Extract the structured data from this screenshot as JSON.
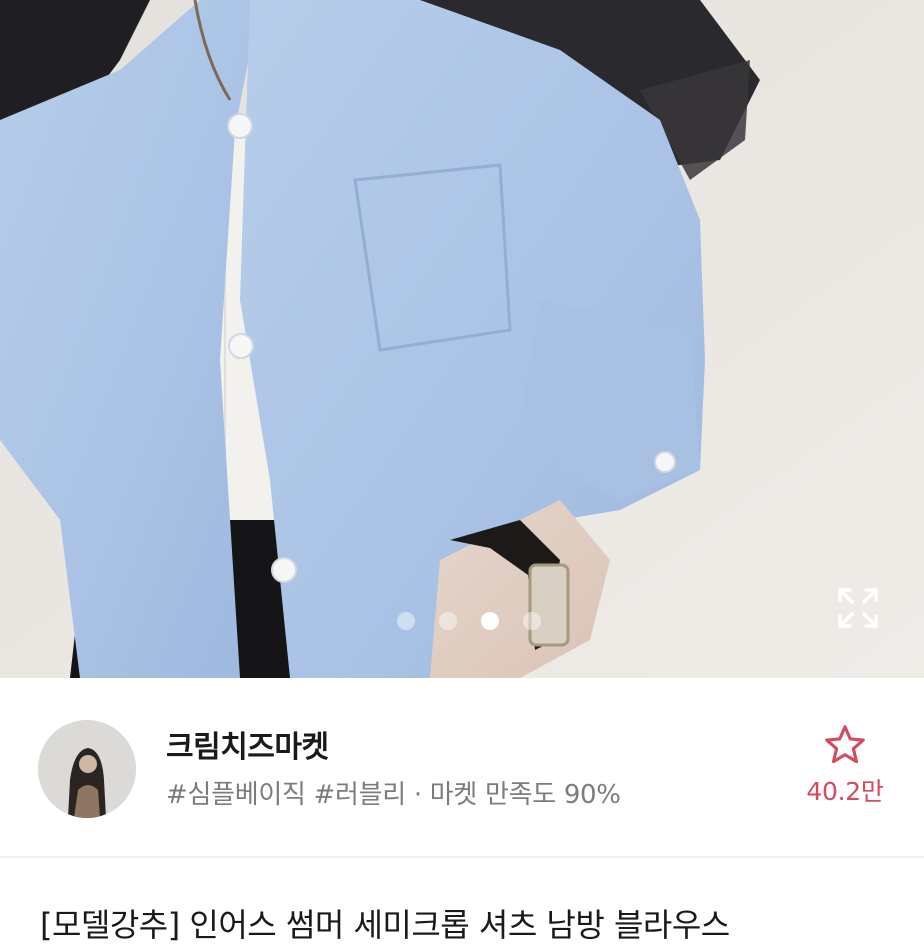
{
  "photo": {
    "alt_icon": "expand-icon",
    "carousel": {
      "total": 4,
      "active_index": 2
    }
  },
  "shop": {
    "name": "크림치즈마켓",
    "tags": "#심플베이직 #러블리 · 마켓 만족도 90%",
    "favorite_icon": "star-outline-icon",
    "favorite_count": "40.2만",
    "accent_color": "#d44a5e"
  },
  "product": {
    "title": "[모델강추] 인어스 썸머 세미크롭 셔츠 남방 블라우스"
  }
}
